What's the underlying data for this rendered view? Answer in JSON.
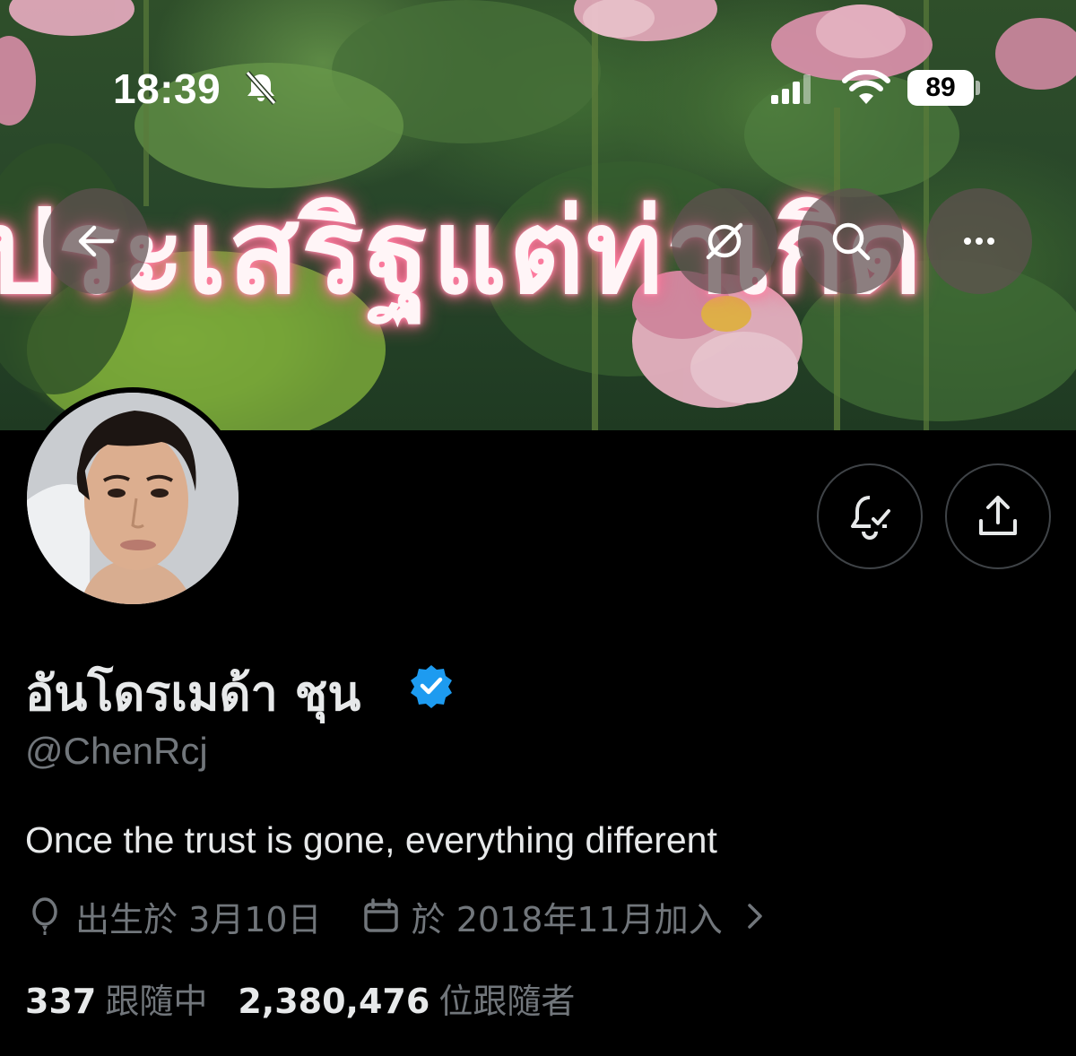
{
  "status_bar": {
    "time": "18:39",
    "battery": "89",
    "icons": [
      "bell-muted-icon",
      "cellular-signal-icon",
      "wifi-icon",
      "battery-icon"
    ]
  },
  "banner": {
    "overlay_text": "ประเสริฐแต่ท่าเกิด",
    "buttons": [
      "back-arrow-icon",
      "grok-icon",
      "search-icon",
      "more-icon"
    ]
  },
  "profile": {
    "display_name": "อันโดรเมด้า ชุน",
    "verified": true,
    "handle": "@ChenRcj",
    "bio": "Once the trust is gone, everything different",
    "birthday": "出生於 3月10日",
    "joined": "於 2018年11月加入",
    "following_count": "337",
    "following_label": "跟隨中",
    "followers_count": "2,380,476",
    "followers_label": "位跟隨者"
  },
  "actions": [
    "notification-bell-icon",
    "share-icon"
  ],
  "colors": {
    "background": "#000000",
    "primary_text": "#e7e9ea",
    "secondary_text": "#71767b",
    "verified_blue": "#1d9bf0",
    "banner_glow": "#ff5a86"
  }
}
